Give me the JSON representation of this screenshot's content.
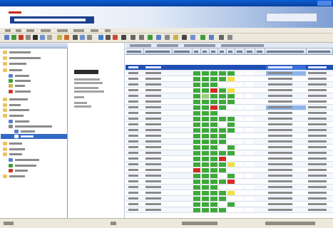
{
  "colors": {
    "title_bar": "#0a4fc0",
    "banner_end": "#7e9ed4",
    "nav_selection": "#316ac5",
    "active_row": "#1f4fb5",
    "cell_green": "#3ea838",
    "cell_red": "#d42a24",
    "cell_yellow": "#f0e040",
    "cell_lightgreen": "#9ccd7a"
  },
  "icons": {
    "app_logo": "app-logo-icon",
    "folder": "folder-icon",
    "tree_expand": "tree-expand-icon"
  }
}
